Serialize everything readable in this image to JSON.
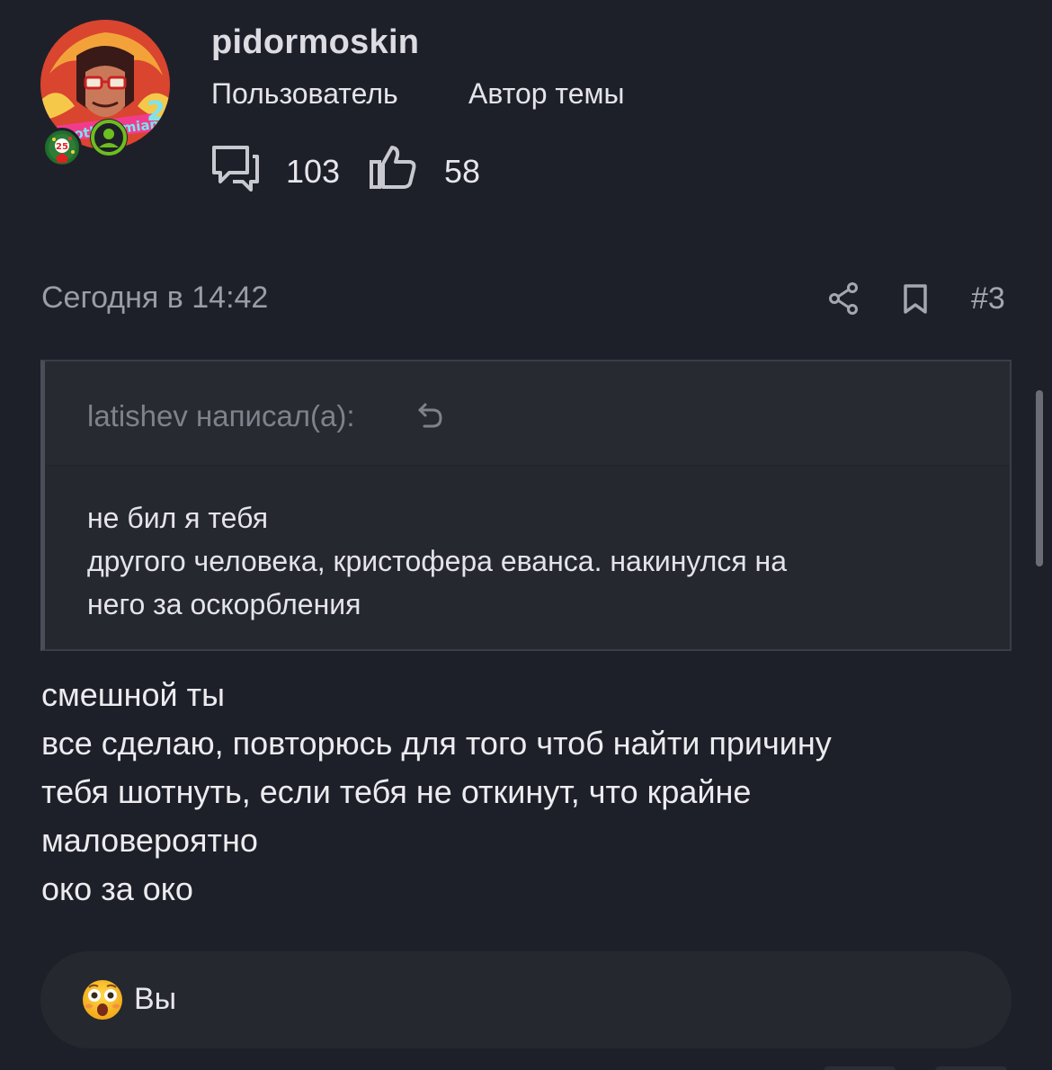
{
  "author": {
    "username": "pidormoskin",
    "role": "Пользователь",
    "badge": "Автор темы",
    "avatar_badge_number": "25",
    "messages_count": "103",
    "likes_count": "58"
  },
  "post": {
    "time": "Сегодня в 14:42",
    "number": "#3",
    "quote": {
      "author_line": "latishev написал(а):",
      "lines": [
        "не бил я тебя",
        "другого человека, кристофера еванса. накинулся на",
        "него за оскорбления"
      ]
    },
    "body_lines": [
      "смешной ты",
      "все сделаю, повторюсь для того чтоб найти причину",
      "тебя шотнуть, если тебя не откинут, что крайне",
      "маловероятно",
      "око за око"
    ]
  },
  "reactions": {
    "emoji": "astonished-face-icon",
    "label": "Вы"
  },
  "colors": {
    "background": "#1e2029",
    "quote_bg": "#262830",
    "muted_text": "#9a9ca6",
    "badge_green": "#6cbf1e"
  }
}
